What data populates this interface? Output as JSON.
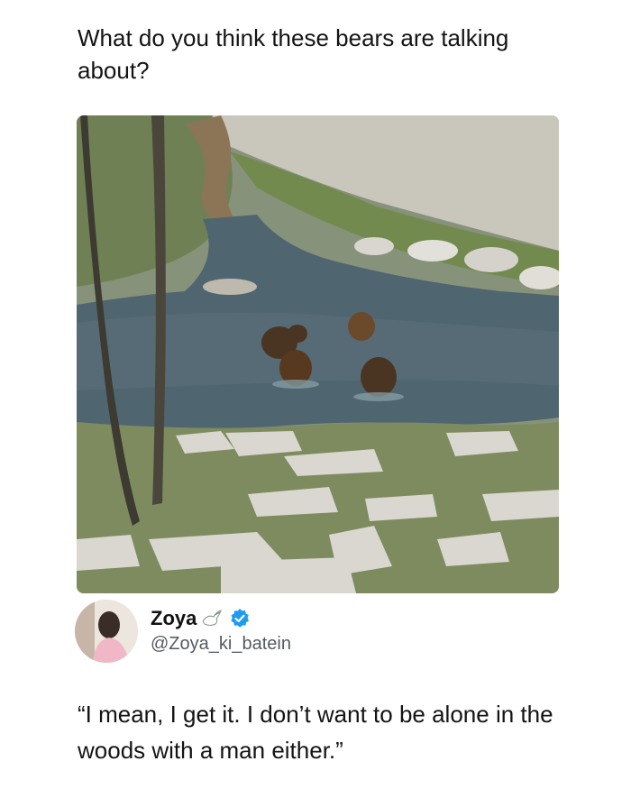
{
  "post": {
    "question": "What do you think these bears are talking about?",
    "image_description_icon": "bears-in-river-photo"
  },
  "tweet": {
    "display_name": "Zoya",
    "handle": "@Zoya_ki_batein",
    "text": "“I mean, I get it. I don’t want to be alone in the woods with a man either.”",
    "badge_icon": "verified-icon",
    "name_emoji_icon": "dove-icon",
    "accent_color": "#1d9bf0"
  }
}
